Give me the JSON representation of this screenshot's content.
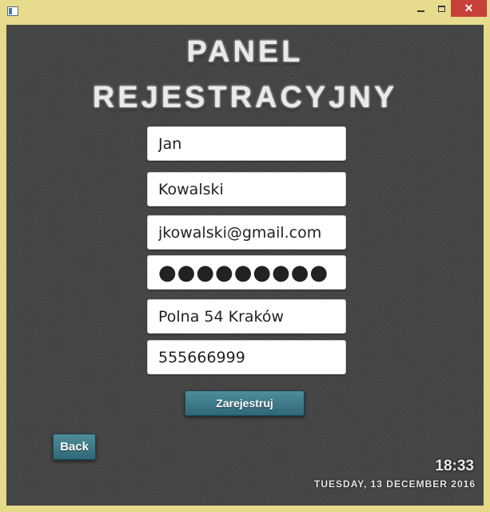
{
  "window": {
    "close_glyph": "✕"
  },
  "header": {
    "line1": "PANEL",
    "line2": "REJESTRACYJNY"
  },
  "form": {
    "first_name": "Jan",
    "last_name": "Kowalski",
    "email": "jkowalski@gmail.com",
    "password_masked": "●●●●●●●●●",
    "address": "Polna 54 Kraków",
    "phone": "555666999"
  },
  "actions": {
    "register_label": "Zarejestruj",
    "back_label": "Back"
  },
  "status": {
    "time": "18:33",
    "date": "TUESDAY, 13 DECEMBER 2016"
  }
}
